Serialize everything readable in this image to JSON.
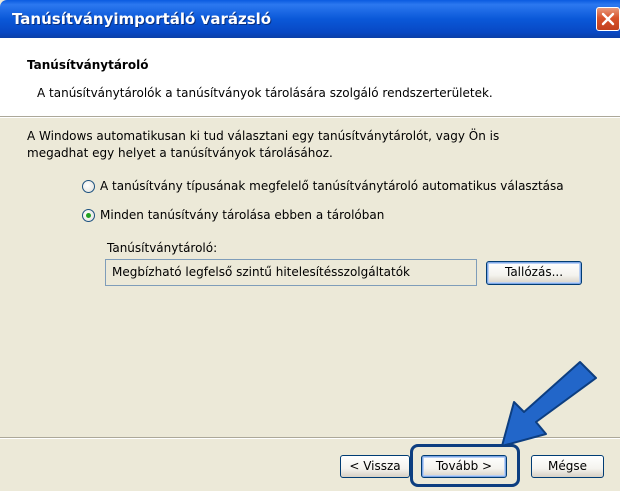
{
  "window": {
    "title": "Tanúsítványimportáló varázsló"
  },
  "header": {
    "title": "Tanúsítványtároló",
    "description": "A tanúsítványtárolók a tanúsítványok tárolására szolgáló rendszerterületek."
  },
  "body": {
    "intro_line1": "A Windows automatikusan ki tud választani egy tanúsítványtárolót, vagy Ön is",
    "intro_line2": "megadhat egy helyet a tanúsítványok tárolásához.",
    "options": [
      {
        "label": "A tanúsítvány típusának megfelelő tanúsítványtároló automatikus választása",
        "selected": false
      },
      {
        "label": "Minden tanúsítvány tárolása ebben a tárolóban",
        "selected": true
      }
    ],
    "store_label": "Tanúsítványtároló:",
    "store_value": "Megbízható legfelső szintű hitelesítésszolgáltatók",
    "browse_label": "Tallózás..."
  },
  "footer": {
    "back_label": "< Vissza",
    "next_label": "Tovább >",
    "cancel_label": "Mégse"
  },
  "colors": {
    "titlebar": "#0A58D8",
    "dialog_bg": "#ECE9D8",
    "annotation": "#0D3E80"
  },
  "icons": {
    "close": "close-icon",
    "annotation": "arrow-pointer-icon"
  }
}
